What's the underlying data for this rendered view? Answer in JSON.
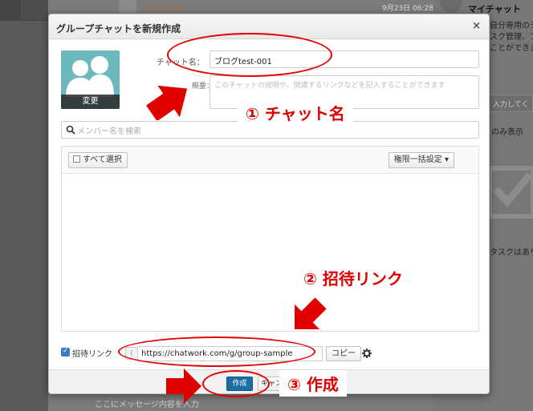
{
  "background": {
    "message_sender": "たびびと JIN",
    "message_date": "9月23日 06:28",
    "right_panel_title": "マイチャット",
    "right_panel_desc": "自分専用のチ\nスク管理、フ\nことができま",
    "right_panel_input_placeholder": "入力してく",
    "right_panel_show": "のみ表示",
    "right_panel_task": "タスクはあり",
    "compose_placeholder": "ここにメッセージ内容を入力"
  },
  "dialog": {
    "title": "グループチャットを新規作成",
    "close_label": "×",
    "icon_change_label": "変更",
    "chat_name_label": "チャット名：",
    "chat_name_value": "ブログtest-001",
    "description_label": "概要：",
    "description_placeholder": "このチャットの説明や、関連するリンクなどを記入することができます",
    "member_search_placeholder": "メンバー名を検索",
    "select_all_label": "すべて選択",
    "bulk_permission_label": "権限一括設定 ▾",
    "invite_link_label": "招待リンク",
    "invite_link_prefix": "(",
    "invite_link_value": "https://chatwork.com/g/group-sample",
    "copy_label": "コピー",
    "create_label": "作成",
    "cancel_label": "キャンセル"
  },
  "annotations": {
    "step1": "① チャット名",
    "step2": "② 招待リンク",
    "step3": "③ 作成",
    "color": "#e10000"
  }
}
